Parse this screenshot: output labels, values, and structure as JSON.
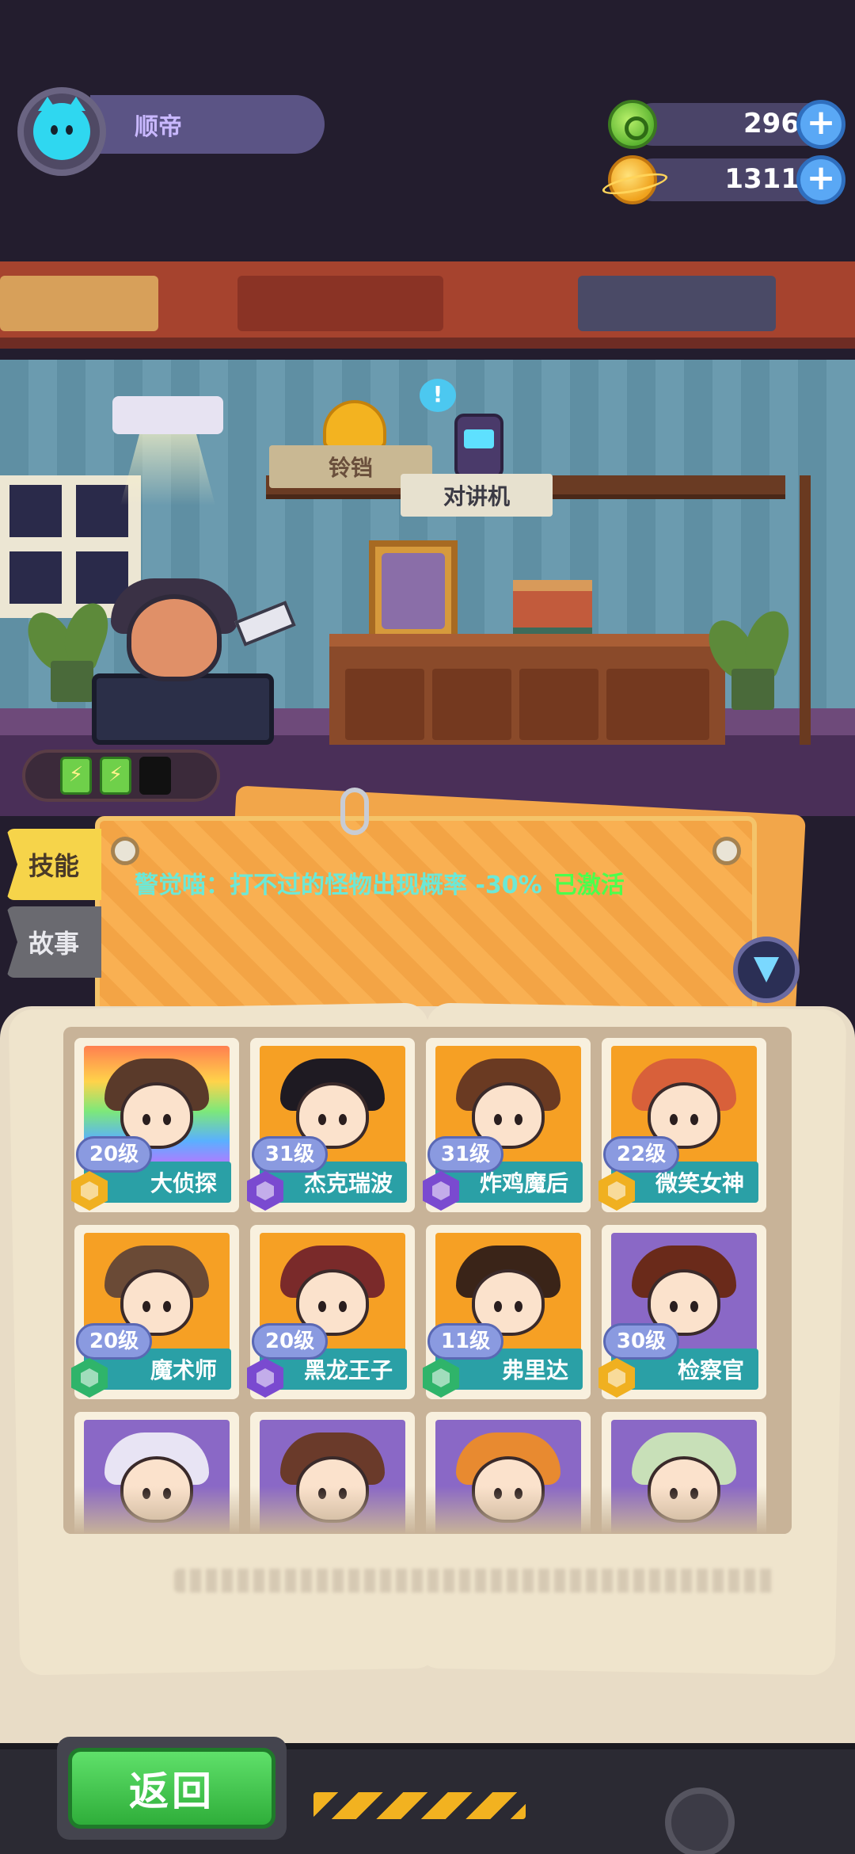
{
  "player": {
    "name": "顺帝"
  },
  "currencies": [
    {
      "name": "green-coin",
      "amount": "296",
      "color": "#7fd14a"
    },
    {
      "name": "gold-coin",
      "amount": "1311",
      "color": "#f6b21e"
    }
  ],
  "room": {
    "bell_label": "铃铛",
    "walkie_label": "对讲机",
    "bubble": "!",
    "batteries": [
      "charged",
      "charged",
      "empty"
    ]
  },
  "tabs": {
    "skill": "技能",
    "story": "故事"
  },
  "skill": {
    "description": "警觉喵：打不过的怪物出现概率 -30%",
    "status": "已激活",
    "desc_color": "#6ce8d6",
    "status_color": "#4cff4c"
  },
  "heroes": [
    {
      "name": "大侦探",
      "level": "20级",
      "rarity": "gold",
      "bg": "rainbow",
      "hair": "#5a3a2a"
    },
    {
      "name": "杰克瑞波",
      "level": "31级",
      "rarity": "purple",
      "bg": "gold",
      "hair": "#1e1a22"
    },
    {
      "name": "炸鸡魔后",
      "level": "31级",
      "rarity": "purple",
      "bg": "gold",
      "hair": "#6a3a22"
    },
    {
      "name": "微笑女神",
      "level": "22级",
      "rarity": "gold",
      "bg": "gold",
      "hair": "#d8603a"
    },
    {
      "name": "魔术师",
      "level": "20级",
      "rarity": "green",
      "bg": "gold",
      "hair": "#6a4a36"
    },
    {
      "name": "黑龙王子",
      "level": "20级",
      "rarity": "purple",
      "bg": "gold",
      "hair": "#7a2a2a"
    },
    {
      "name": "弗里达",
      "level": "11级",
      "rarity": "green",
      "bg": "gold",
      "hair": "#3a2418"
    },
    {
      "name": "检察官",
      "level": "30级",
      "rarity": "gold",
      "bg": "purple",
      "hair": "#6a2a1a"
    },
    {
      "name": "",
      "level": "",
      "rarity": "none",
      "bg": "purple",
      "hair": "#e8e4f4"
    },
    {
      "name": "",
      "level": "",
      "rarity": "none",
      "bg": "purple",
      "hair": "#6a3a2a"
    },
    {
      "name": "",
      "level": "",
      "rarity": "none",
      "bg": "purple",
      "hair": "#e88a30"
    },
    {
      "name": "",
      "level": "",
      "rarity": "none",
      "bg": "purple",
      "hair": "#c8e0b8"
    }
  ],
  "bottom": {
    "back_label": "返回"
  },
  "colors": {
    "background": "#231d2e",
    "accent_green": "#2fae3a",
    "card_orange": "#f7a94a",
    "hero_namebar": "#2aa0a6"
  }
}
